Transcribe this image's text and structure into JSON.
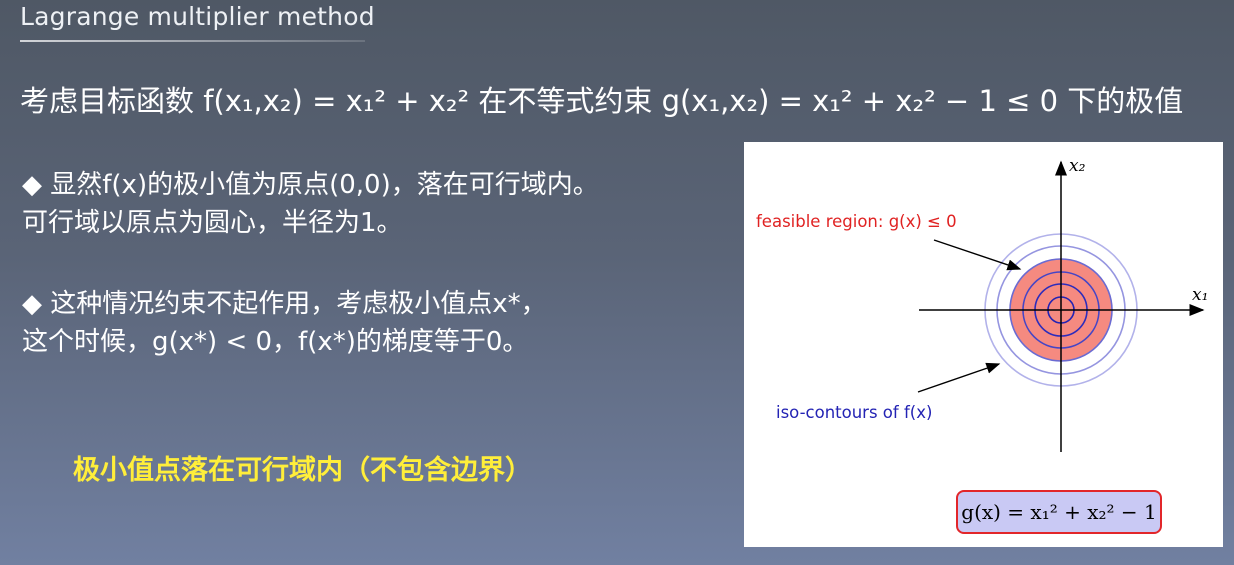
{
  "slide": {
    "title": "Lagrange multiplier method",
    "formula_line": "考虑目标函数 f(x₁,x₂) = x₁² + x₂² 在不等式约束 g(x₁,x₂) = x₁² + x₂² − 1 ≤ 0 下的极值",
    "bullets": [
      {
        "line1": "◆ 显然f(x)的极小值为原点(0,0)，落在可行域内。",
        "line2": "可行域以原点为圆心，半径为1。"
      },
      {
        "line1": "◆ 这种情况约束不起作用，考虑极小值点x*，",
        "line2": "这个时候，g(x*) < 0，f(x*)的梯度等于0。"
      }
    ],
    "conclusion": "极小值点落在可行域内（不包含边界）"
  },
  "figure": {
    "x_axis_label": "x₁",
    "y_axis_label": "x₂",
    "feasible_label": "feasible region: g(x) ≤ 0",
    "iso_label": "iso-contours of f(x)",
    "constraint_formula": "g(x) = x₁² + x₂² − 1",
    "colors": {
      "feasible_fill": "#f58a80",
      "contour_inner": "#2323b4",
      "contour_outer": "#9595e0",
      "feasible_label": "#e02222",
      "iso_label": "#2323b4",
      "constraint_box_border": "#e2262a",
      "constraint_box_fill": "#c9c9f4"
    }
  }
}
